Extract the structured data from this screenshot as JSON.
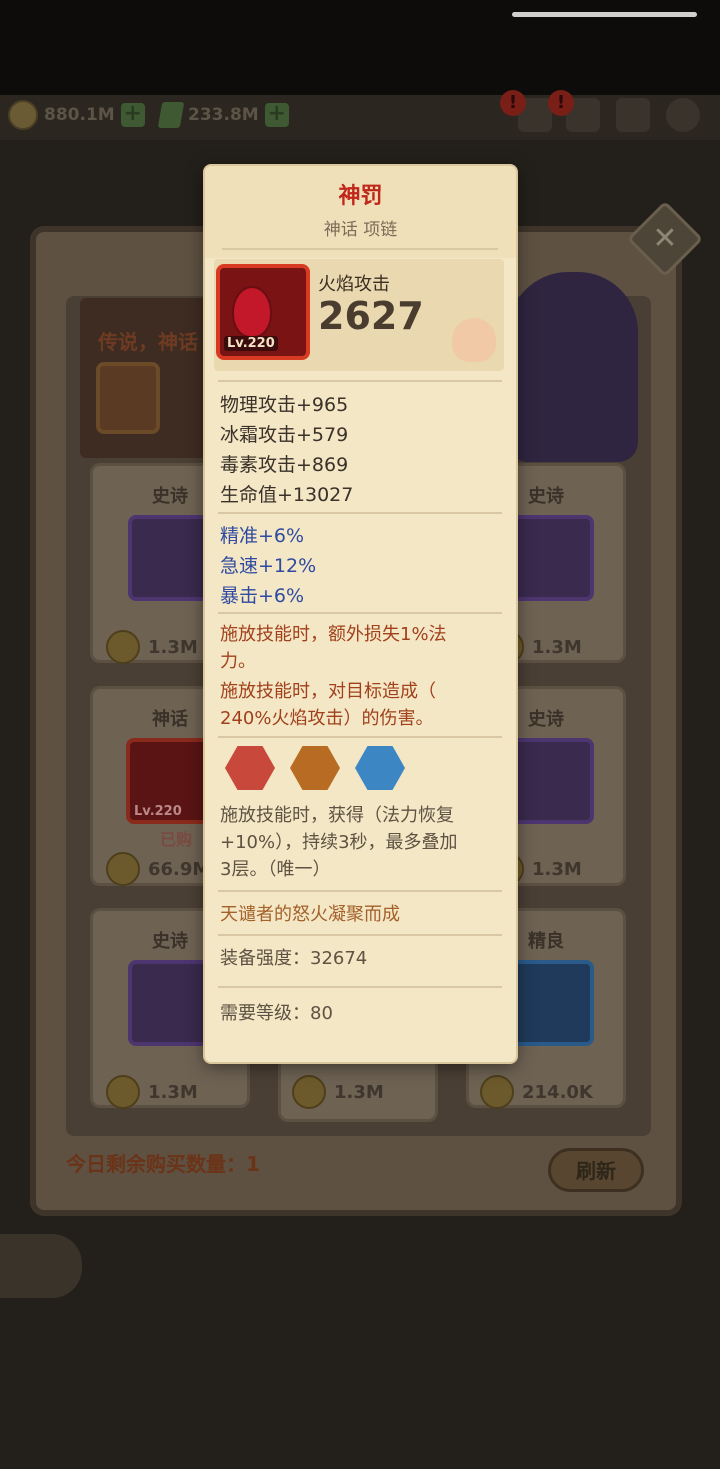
{
  "hud": {
    "gold": "880.1M",
    "gems": "233.8M"
  },
  "shop": {
    "banner_text": "传说，神话",
    "cards": [
      {
        "rarity": "史诗",
        "price": "1.3M"
      },
      {
        "rarity": "史诗",
        "price": "1.3M"
      },
      {
        "rarity": "神话",
        "price": "66.9M",
        "level": "Lv.220",
        "sold": "已购"
      },
      {
        "rarity": "史诗",
        "price": "1.3M"
      },
      {
        "rarity": "史诗",
        "price": "1.3M"
      },
      {
        "rarity": "",
        "price": "1.3M"
      },
      {
        "rarity": "精良",
        "price": "214.0K"
      }
    ],
    "remaining_label": "今日剩余购买数量：1",
    "refresh_label": "刷新"
  },
  "tooltip": {
    "name": "神罚",
    "subtitle": "神话 项链",
    "item_level": "Lv.220",
    "main_stat_label": "火焰攻击",
    "main_stat_value": "2627",
    "base_stats": [
      "物理攻击+965",
      "冰霜攻击+579",
      "毒素攻击+869",
      "生命值+13027"
    ],
    "bonus_stats": [
      "精准+6%",
      "急速+12%",
      "暴击+6%"
    ],
    "effect_lines": [
      "施放技能时，额外损失1%法",
      "力。",
      "施放技能时，对目标造成（",
      "240%火焰攻击）的伤害。"
    ],
    "socket_colors": [
      "#c8483c",
      "#b86b22",
      "#3d86c4"
    ],
    "socket_text": [
      "施放技能时，获得（法力恢复",
      "+10%），持续3秒，最多叠加",
      "3层。（唯一）"
    ],
    "flavor": "天谴者的怒火凝聚而成",
    "power": "装备强度：32674",
    "required_level": "需要等级：80"
  }
}
